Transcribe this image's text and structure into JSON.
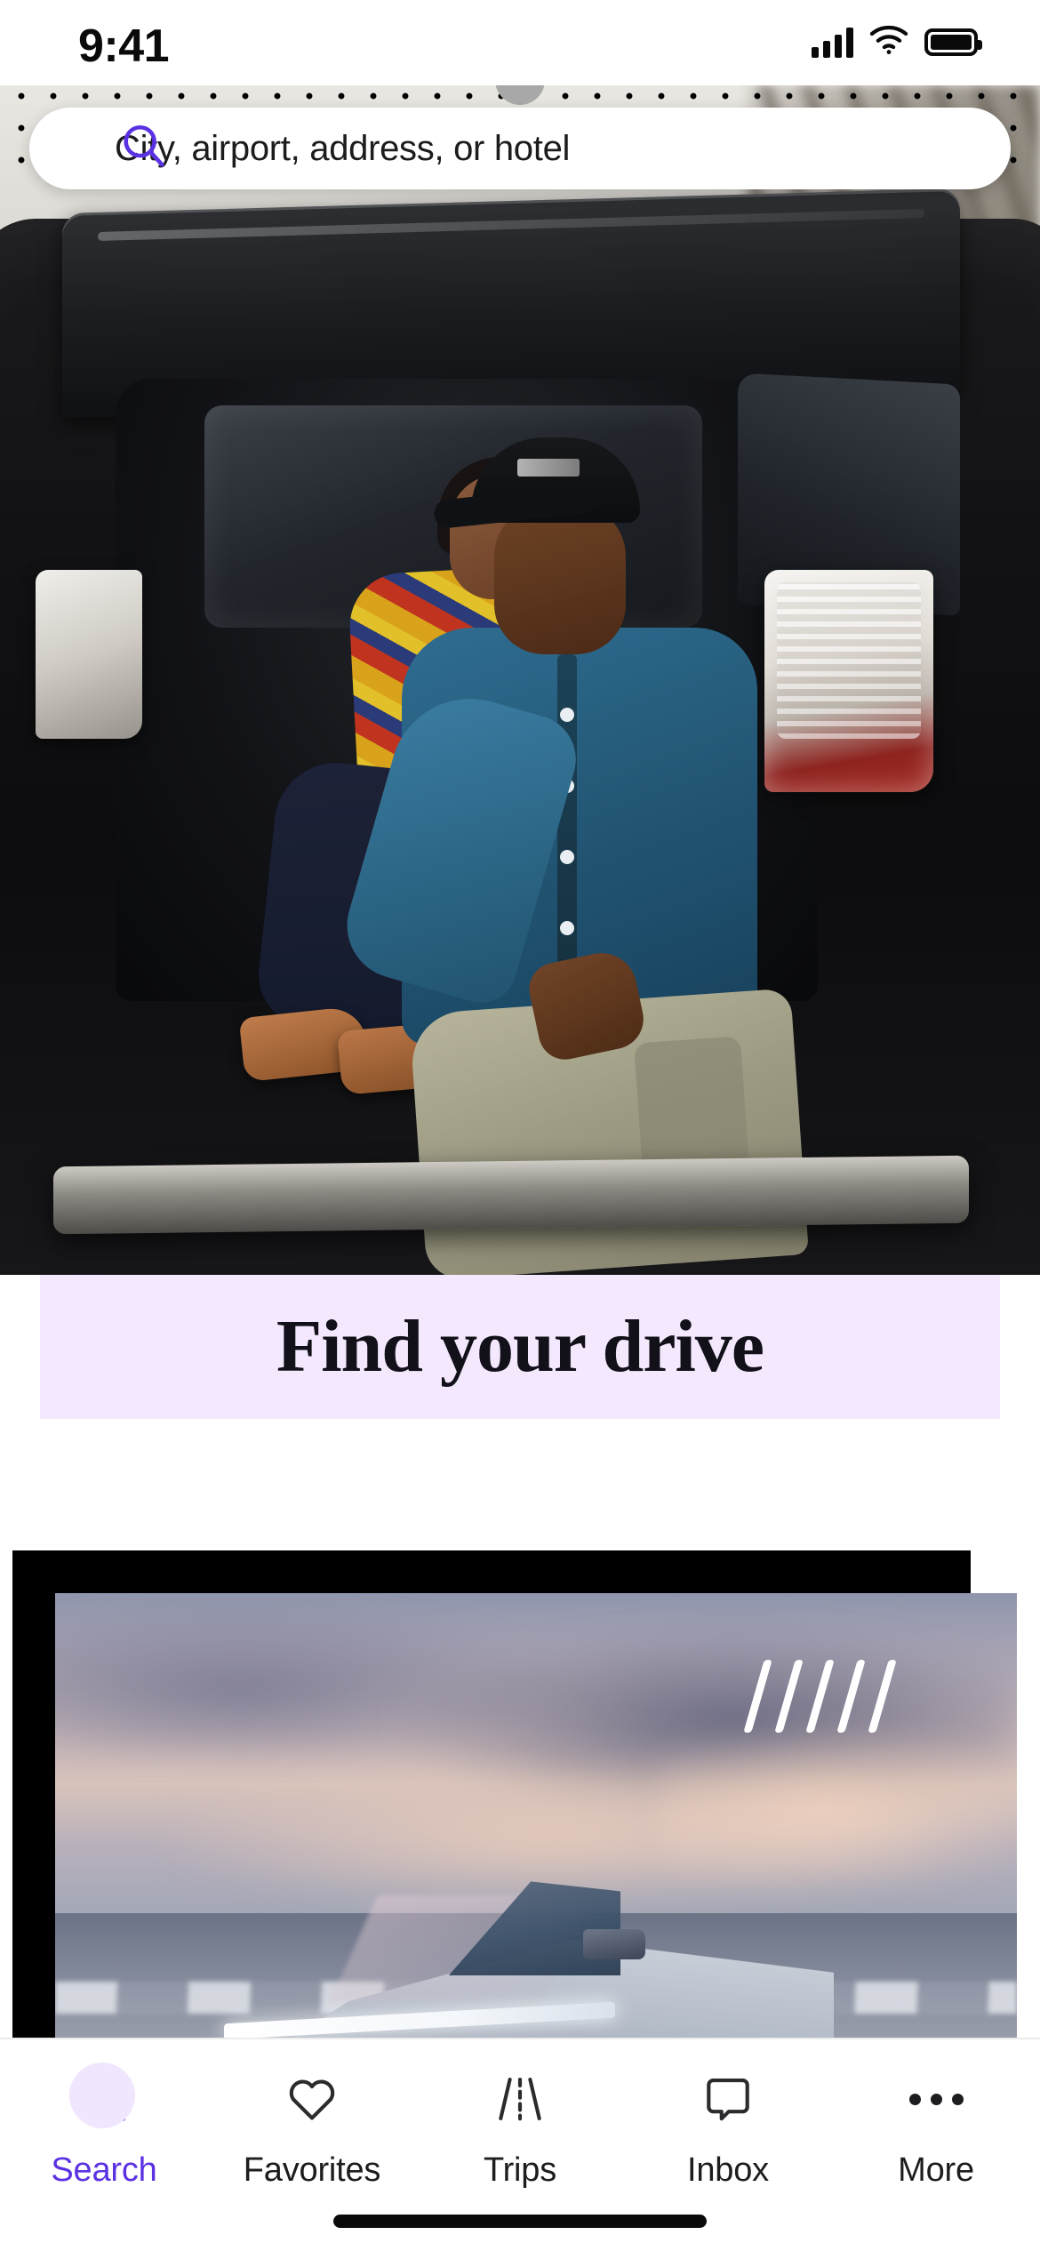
{
  "status_bar": {
    "time": "9:41",
    "cellular_icon": "signal-bars-icon",
    "wifi_icon": "wifi-icon",
    "battery_icon": "battery-full-icon"
  },
  "search": {
    "icon": "search-icon",
    "placeholder": "City, airport, address, or hotel",
    "value": ""
  },
  "hero": {
    "alt": "Couple sitting in the open trunk of an SUV outdoors",
    "overlay_pattern": "halftone-dots"
  },
  "headline": {
    "text": "Find your drive",
    "background_color": "#f3e8fd",
    "text_color": "#121018"
  },
  "promo_card": {
    "alt": "Silver Tesla Cybertruck parked on a beach at sunset",
    "decoration": "diagonal-slashes",
    "slash_count": 5,
    "backing_color": "#000000"
  },
  "tab_bar": {
    "active_index": 0,
    "accent_color": "#5b32e3",
    "active_pill_color": "#f0e6fe",
    "items": [
      {
        "label": "Search",
        "icon": "search-icon"
      },
      {
        "label": "Favorites",
        "icon": "heart-icon"
      },
      {
        "label": "Trips",
        "icon": "road-icon"
      },
      {
        "label": "Inbox",
        "icon": "speech-bubble-icon"
      },
      {
        "label": "More",
        "icon": "ellipsis-icon"
      }
    ]
  }
}
